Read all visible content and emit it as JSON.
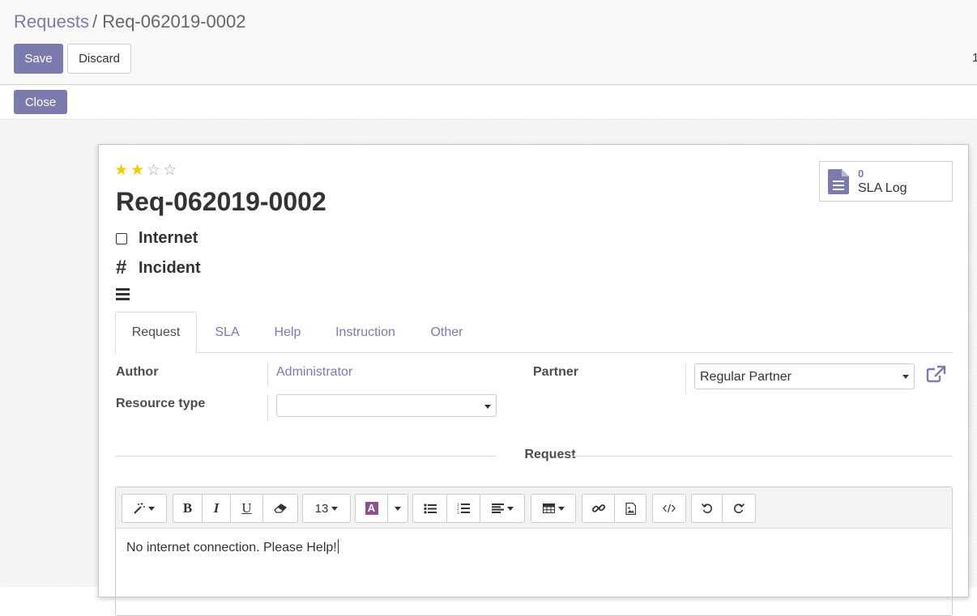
{
  "breadcrumb": {
    "parent": "Requests",
    "separator": "/",
    "current": "Req-062019-0002"
  },
  "control": {
    "save_label": "Save",
    "discard_label": "Discard",
    "pager_text": "1"
  },
  "statusbar": {
    "close_label": "Close"
  },
  "request": {
    "priority_stars": 2,
    "priority_max": 5,
    "name": "Req-062019-0002",
    "category": "Internet",
    "type": "Incident"
  },
  "smart_button": {
    "count": "0",
    "label": "SLA Log",
    "icon": "document-icon"
  },
  "tabs": [
    {
      "label": "Request",
      "active": true
    },
    {
      "label": "SLA",
      "active": false
    },
    {
      "label": "Help",
      "active": false
    },
    {
      "label": "Instruction",
      "active": false
    },
    {
      "label": "Other",
      "active": false
    }
  ],
  "fields": {
    "author_label": "Author",
    "author_value": "Administrator",
    "partner_label": "Partner",
    "partner_value": "Regular Partner",
    "resource_type_label": "Resource type",
    "resource_type_value": ""
  },
  "section": {
    "label": "Request"
  },
  "editor": {
    "font_size": "13",
    "content": "No internet connection. Please Help!",
    "toolbar_icons": [
      "magic-wand-icon",
      "bold-icon",
      "italic-icon",
      "underline-icon",
      "eraser-icon",
      "font-size-dropdown",
      "font-color-icon",
      "unordered-list-icon",
      "ordered-list-icon",
      "paragraph-align-icon",
      "table-icon",
      "link-icon",
      "image-icon",
      "code-view-icon",
      "undo-icon",
      "redo-icon"
    ]
  },
  "colors": {
    "accent": "#7c7bad",
    "star": "#f3cc00",
    "text": "#4c4c4c"
  }
}
